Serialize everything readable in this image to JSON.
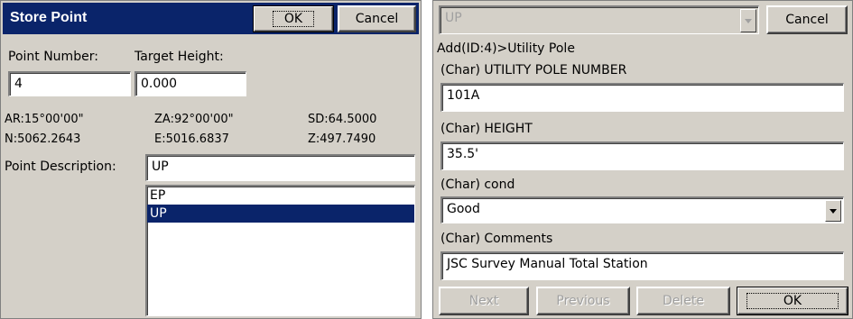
{
  "left_dialog": {
    "title": "Store Point",
    "ok_label": "OK",
    "cancel_label": "Cancel",
    "point_number_label": "Point Number:",
    "point_number_value": "4",
    "target_height_label": "Target Height:",
    "target_height_value": "0.000",
    "readouts": {
      "ar": "AR:15°00'00\"",
      "za": "ZA:92°00'00\"",
      "sd": "SD:64.5000",
      "n": "N:5062.2643",
      "e": "E:5016.6837",
      "z": "Z:497.7490"
    },
    "point_description_label": "Point Description:",
    "point_description_value": "UP",
    "description_list": [
      "EP",
      "UP"
    ],
    "selected_index": 1
  },
  "right_dialog": {
    "code_select_value": "UP",
    "cancel_label": "Cancel",
    "header": "Add(ID:4)>Utility Pole",
    "fields": [
      {
        "label": "(Char) UTILITY POLE NUMBER",
        "value": "101A"
      },
      {
        "label": "(Char) HEIGHT",
        "value": "35.5'"
      },
      {
        "label": "(Char) cond",
        "value": "Good"
      },
      {
        "label": "(Char) Comments",
        "value": "JSC Survey Manual Total Station"
      }
    ],
    "buttons": {
      "next": "Next",
      "previous": "Previous",
      "delete": "Delete",
      "ok": "OK"
    }
  },
  "colors": {
    "title_bar": "#0a246a",
    "selection": "#0a246a",
    "face": "#d4d0c8"
  },
  "icons": [
    "chevron-down-icon"
  ]
}
